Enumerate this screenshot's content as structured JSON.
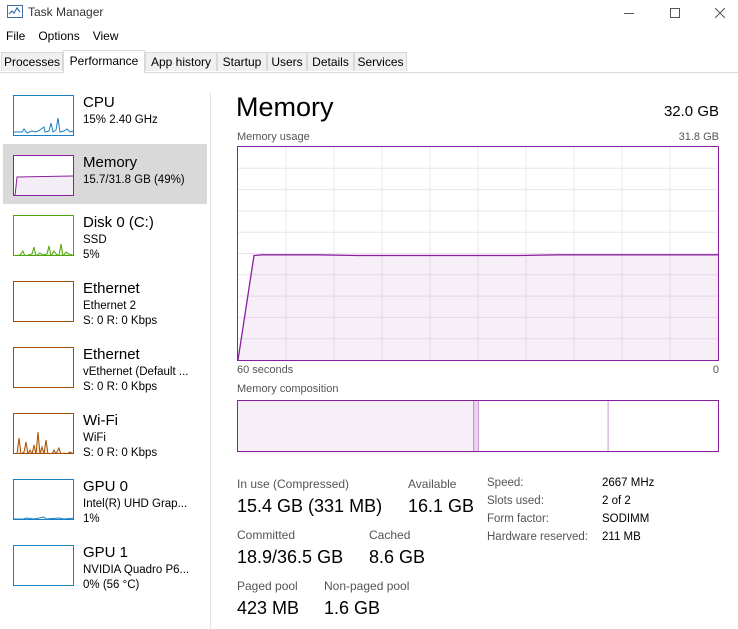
{
  "window": {
    "title": "Task Manager",
    "icon": "task-manager-icon",
    "controls": [
      "minimize-icon",
      "maximize-icon",
      "close-icon"
    ]
  },
  "menu": [
    "File",
    "Options",
    "View"
  ],
  "tabs": [
    {
      "label": "Processes",
      "active": false
    },
    {
      "label": "Performance",
      "active": true
    },
    {
      "label": "App history",
      "active": false
    },
    {
      "label": "Startup",
      "active": false
    },
    {
      "label": "Users",
      "active": false
    },
    {
      "label": "Details",
      "active": false
    },
    {
      "label": "Services",
      "active": false
    }
  ],
  "sidebar": [
    {
      "name": "CPU",
      "line1": "15%  2.40 GHz",
      "line2": "",
      "color": "#1a80c4"
    },
    {
      "name": "Memory",
      "line1": "15.7/31.8 GB (49%)",
      "line2": "",
      "color": "#8b1e9e",
      "selected": true
    },
    {
      "name": "Disk 0 (C:)",
      "line1": "SSD",
      "line2": "5%",
      "color": "#4da60c"
    },
    {
      "name": "Ethernet",
      "line1": "Ethernet 2",
      "line2": "S: 0  R: 0 Kbps",
      "color": "#a74f01"
    },
    {
      "name": "Ethernet",
      "line1": "vEthernet (Default ...",
      "line2": "S: 0  R: 0 Kbps",
      "color": "#a74f01"
    },
    {
      "name": "Wi-Fi",
      "line1": "WiFi",
      "line2": "S: 0  R: 0 Kbps",
      "color": "#a74f01"
    },
    {
      "name": "GPU 0",
      "line1": "Intel(R) UHD Grap...",
      "line2": "1%",
      "color": "#1a80c4"
    },
    {
      "name": "GPU 1",
      "line1": "NVIDIA Quadro P6...",
      "line2": "0%  (56 °C)",
      "color": "#1a80c4"
    }
  ],
  "main": {
    "title": "Memory",
    "total": "32.0 GB",
    "usage_label": "Memory usage",
    "usage_max": "31.8 GB",
    "x_left": "60 seconds",
    "x_right": "0",
    "composition_label": "Memory composition",
    "stats": {
      "in_use_label": "In use (Compressed)",
      "in_use_value": "15.4 GB (331 MB)",
      "available_label": "Available",
      "available_value": "16.1 GB",
      "committed_label": "Committed",
      "committed_value": "18.9/36.5 GB",
      "cached_label": "Cached",
      "cached_value": "8.6 GB",
      "paged_label": "Paged pool",
      "paged_value": "423 MB",
      "nonpaged_label": "Non-paged pool",
      "nonpaged_value": "1.6 GB"
    },
    "details": [
      {
        "label": "Speed:",
        "value": "2667 MHz"
      },
      {
        "label": "Slots used:",
        "value": "2 of 2"
      },
      {
        "label": "Form factor:",
        "value": "SODIMM"
      },
      {
        "label": "Hardware reserved:",
        "value": "211 MB"
      }
    ],
    "accent": "#8b1e9e"
  },
  "chart_data": {
    "type": "area",
    "x": [
      60,
      58,
      57,
      55,
      50,
      45,
      40,
      35,
      30,
      25,
      20,
      15,
      10,
      5,
      0
    ],
    "series": [
      {
        "values": [
          0,
          15.6,
          15.7,
          15.7,
          15.7,
          15.6,
          15.6,
          15.6,
          15.6,
          15.6,
          15.7,
          15.7,
          15.7,
          15.7,
          15.7
        ]
      }
    ],
    "ylim": [
      0,
      31.8
    ],
    "xlim": [
      60,
      0
    ],
    "grid": true,
    "composition_fractions": {
      "in_use": 0.49,
      "modified": 0.01,
      "standby": 0.27,
      "free": 0.23
    }
  }
}
